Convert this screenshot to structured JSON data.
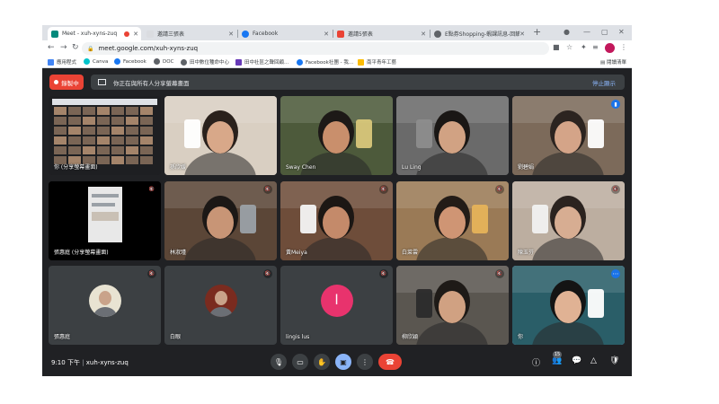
{
  "browser": {
    "tabs": [
      {
        "label": "Meet - xuh-xyns-zuq",
        "active": true,
        "favicon_color": "#00897b"
      },
      {
        "label": "邀請三張表",
        "active": false,
        "favicon_color": "#dadce0"
      },
      {
        "label": "Facebook",
        "active": false,
        "favicon_color": "#1877f2"
      },
      {
        "label": "邀請5張表",
        "active": false,
        "favicon_color": "#ea4335"
      },
      {
        "label": "E點券Shopping-蝦課訊息-回饋",
        "active": false,
        "favicon_color": "#5f6368"
      }
    ],
    "url": "meet.google.com/xuh-xyns-zuq",
    "bookmarks": [
      {
        "label": "應用程式",
        "color": "#4285f4"
      },
      {
        "label": "Canva",
        "color": "#00c4cc"
      },
      {
        "label": "Facebook",
        "color": "#1877f2"
      },
      {
        "label": "DOC",
        "color": "#5f6368"
      },
      {
        "label": "田中數位種命中心",
        "color": "#5f6368"
      },
      {
        "label": "田中社區之聲回顧...",
        "color": "#673ab7"
      },
      {
        "label": "Facebook社團 - 我...",
        "color": "#1877f2"
      },
      {
        "label": "南平青年工藝",
        "color": "#fbbc04"
      }
    ],
    "reading_list": "閱讀清單"
  },
  "meet": {
    "record_label": "錄製中",
    "present_banner": "你正在與所有人分享螢幕畫面",
    "stop_present": "停止顯示",
    "participants": [
      {
        "name": "你 (分享螢幕畫面)",
        "muted": false,
        "tile_color": "#1e1f22",
        "type": "screen"
      },
      {
        "name": "孫欣媛",
        "muted": false,
        "tile_color": "#d9cfc2",
        "type": "video",
        "skin": "#d8a889",
        "hair": "#2a211c",
        "prop": "#ffffff"
      },
      {
        "name": "Sway Chen",
        "muted": false,
        "tile_color": "#4d5a3b",
        "type": "video",
        "skin": "#c98f6c",
        "hair": "#1d1917",
        "prop": "#d8c77a"
      },
      {
        "name": "Lu Ling",
        "muted": false,
        "tile_color": "#6a6a6a",
        "type": "video",
        "skin": "#d1a283",
        "hair": "#1a1715",
        "prop": "#8d8d8d"
      },
      {
        "name": "劉碧娟",
        "muted": false,
        "tile_color": "#7c6a5a",
        "type": "video",
        "skin": "#d4a488",
        "hair": "#2c2420",
        "prop": "#ffffff",
        "speaking": true
      },
      {
        "name": "張惠庭 (分享螢幕畫面)",
        "muted": true,
        "tile_color": "#000000",
        "type": "screen2"
      },
      {
        "name": "林淑瑾",
        "muted": true,
        "tile_color": "#5b4637",
        "type": "video",
        "skin": "#c89576",
        "hair": "#1c1816",
        "prop": "#9ba1a6"
      },
      {
        "name": "黃Meiya",
        "muted": true,
        "tile_color": "#6e4d3a",
        "type": "video",
        "skin": "#c48a6a",
        "hair": "#1c1714",
        "prop": "#f4f4f4"
      },
      {
        "name": "白菜雲",
        "muted": true,
        "tile_color": "#9a7a56",
        "type": "video",
        "skin": "#cf9574",
        "hair": "#231c17",
        "prop": "#e6b35a"
      },
      {
        "name": "陳玉芬",
        "muted": true,
        "tile_color": "#bcaea0",
        "type": "video",
        "skin": "#d7ad92",
        "hair": "#2b231f",
        "prop": "#f1f1f1"
      },
      {
        "name": "張惠庭",
        "muted": true,
        "tile_color": "#3c4043",
        "type": "avatar",
        "avatar_bg": "#e8e3d2"
      },
      {
        "name": "白眼",
        "muted": true,
        "tile_color": "#3c4043",
        "type": "avatar",
        "avatar_bg": "#7a2b1f"
      },
      {
        "name": "lingis lus",
        "muted": true,
        "tile_color": "#3c4043",
        "type": "letter",
        "letter": "l",
        "avatar_bg": "#e8336d"
      },
      {
        "name": "柳欣穎",
        "muted": true,
        "tile_color": "#5a5650",
        "type": "video",
        "skin": "#d0a182",
        "hair": "#1e1a17",
        "prop": "#2b2b2b"
      },
      {
        "name": "你",
        "muted": false,
        "tile_color": "#2a5e68",
        "type": "video",
        "skin": "#e0b294",
        "hair": "#141414",
        "prop": "#ffffff",
        "selected": true
      }
    ],
    "time": "9:10 下午",
    "meeting_code": "xuh-xyns-zuq",
    "participant_count": "15"
  },
  "icons": {
    "mic": "mic-icon",
    "camera": "camera-icon",
    "hand": "raise-hand-icon",
    "present": "present-icon",
    "more": "more-icon",
    "end": "end-call-icon",
    "info": "info-icon",
    "people": "people-icon",
    "chat": "chat-icon",
    "activities": "activities-icon",
    "host": "host-controls-icon"
  }
}
